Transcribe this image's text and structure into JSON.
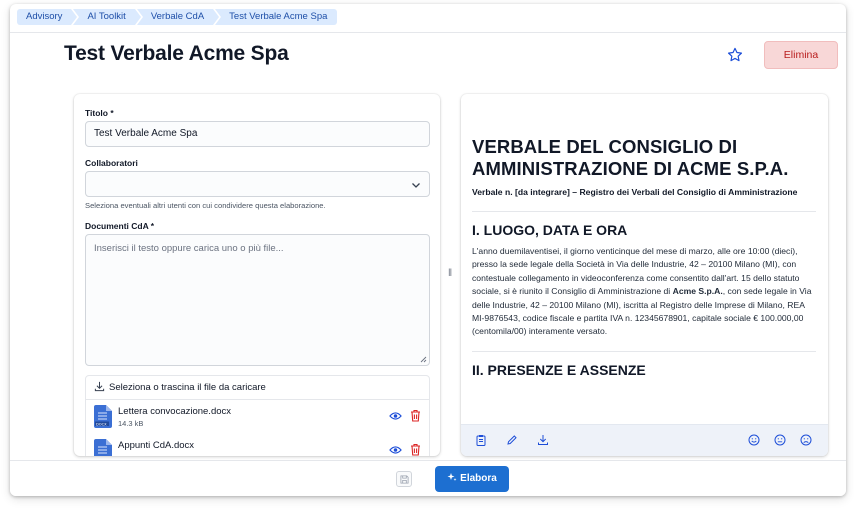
{
  "breadcrumbs": [
    "Advisory",
    "AI Toolkit",
    "Verbale CdA",
    "Test Verbale Acme Spa"
  ],
  "header": {
    "title": "Test Verbale Acme Spa",
    "delete_label": "Elimina"
  },
  "form": {
    "title_label": "Titolo *",
    "title_value": "Test Verbale Acme Spa",
    "collab_label": "Collaboratori",
    "collab_hint": "Seleziona eventuali altri utenti con cui condividere questa elaborazione.",
    "docs_label": "Documenti CdA *",
    "docs_placeholder": "Inserisci il testo oppure carica uno o più file...",
    "upload_label": "Seleziona o trascina il file da caricare",
    "files": [
      {
        "name": "Lettera convocazione.docx",
        "size": "14.3 kB"
      },
      {
        "name": "Appunti CdA.docx",
        "size": ""
      }
    ]
  },
  "document": {
    "title": "VERBALE DEL CONSIGLIO DI AMMINISTRAZIONE DI ACME S.P.A.",
    "subtitle": "Verbale n. [da integrare] – Registro dei Verbali del Consiglio di Amministrazione",
    "section1_title": "I. LUOGO, DATA E ORA",
    "section1_pre": "L'anno duemilaventisei, il giorno venticinque del mese di marzo, alle ore 10:00 (dieci), presso la sede legale della Società in Via delle Industrie, 42 – 20100 Milano (MI), con contestuale collegamento in videoconferenza come consentito dall'art. 15 dello statuto sociale, si è riunito il Consiglio di Amministrazione di ",
    "section1_bold": "Acme S.p.A.",
    "section1_post": ", con sede legale in Via delle Industrie, 42 – 20100 Milano (MI), iscritta al Registro delle Imprese di Milano, REA MI-9876543, codice fiscale e partita IVA n. 12345678901, capitale sociale € 100.000,00 (centomila/00) interamente versato.",
    "section2_title": "II. PRESENZE E ASSENZE"
  },
  "footer": {
    "run_label": "Elabora"
  },
  "colors": {
    "primary": "#1d6fd1",
    "danger_bg": "#f8d7d7",
    "danger_text": "#b91c1c",
    "crumb_bg": "#dbeafe"
  }
}
